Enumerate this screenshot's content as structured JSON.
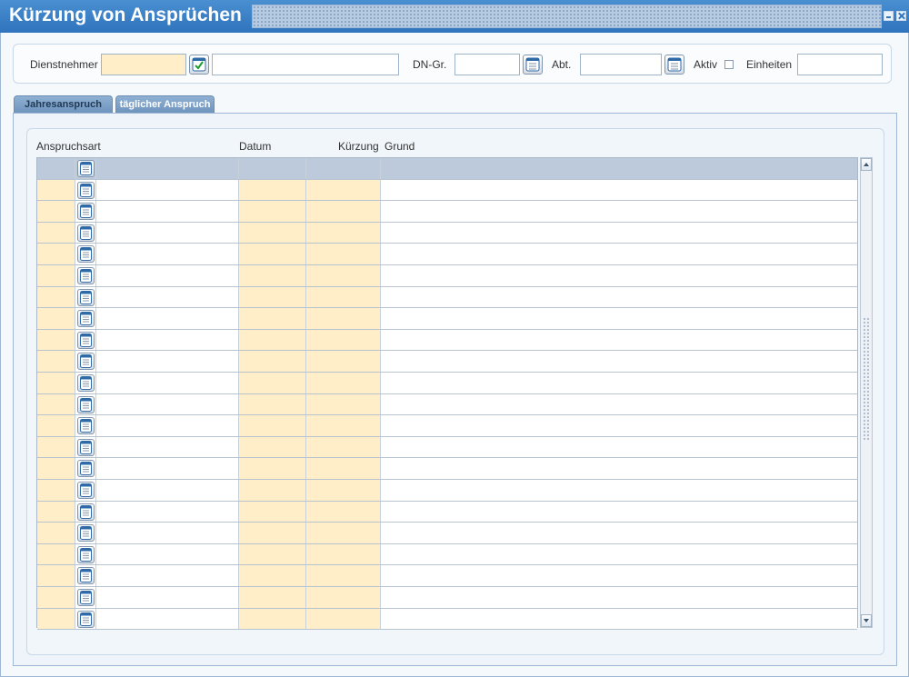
{
  "window": {
    "title": "Kürzung von Ansprüchen"
  },
  "filter": {
    "dienstnehmer_label": "Dienstnehmer",
    "dienstnehmer_value": "",
    "dienstnehmer_name": "",
    "dngr_label": "DN-Gr.",
    "dngr_value": "",
    "abt_label": "Abt.",
    "abt_value": "",
    "aktiv_label": "Aktiv",
    "aktiv_checked": false,
    "einheiten_label": "Einheiten",
    "einheiten_value": ""
  },
  "tabs": [
    {
      "label": "Jahresanspruch",
      "active": false
    },
    {
      "label": "täglicher Anspruch",
      "active": true
    }
  ],
  "grid": {
    "columns": {
      "anspruchsart": "Anspruchsart",
      "datum": "Datum",
      "kuerzung": "Kürzung",
      "grund": "Grund"
    },
    "row_count": 22,
    "rows": []
  },
  "colors": {
    "titlebar": "#3a81c8",
    "required_field": "#ffeec8",
    "header_row": "#bccadb"
  }
}
